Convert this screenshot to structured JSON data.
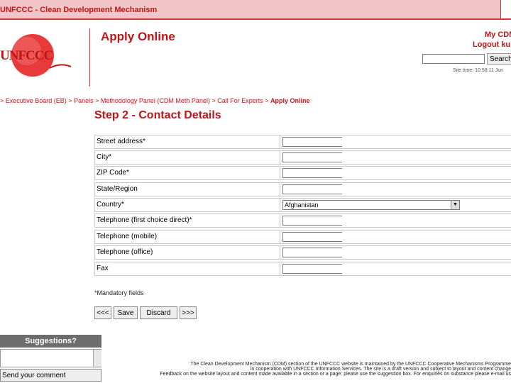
{
  "window": {
    "title": "UNFCCC - Clean Development Mechanism"
  },
  "header": {
    "logo_text": "UNFCCC",
    "page_title": "Apply Online",
    "my_cdm": "My CDM",
    "logout": "Logout ku",
    "search_button": "Search",
    "dateline": "Site time: 10:58:11 Jun"
  },
  "breadcrumb": {
    "items": [
      "> Executive Board (EB) >",
      "Panels >",
      "Methodology Panel (CDM Meth Panel) >",
      "Call For Experts >"
    ],
    "current": "Apply Online"
  },
  "form": {
    "step_title": "Step 2 - Contact Details",
    "rows": [
      {
        "label": "Street address*"
      },
      {
        "label": "City*"
      },
      {
        "label": "ZIP Code*"
      },
      {
        "label": "State/Region"
      },
      {
        "label": "Country*",
        "select_value": "Afghanistan"
      },
      {
        "label": "Telephone (first choice direct)*"
      },
      {
        "label": "Telephone (mobile)"
      },
      {
        "label": "Telephone (office)"
      },
      {
        "label": "Fax"
      }
    ],
    "mandatory_note": "*Mandatory fields",
    "buttons": {
      "prev": "<<<",
      "save": "Save",
      "discard": "Discard",
      "next": ">>>"
    }
  },
  "suggestions": {
    "heading": "Suggestions?",
    "send_button": "Send your comment"
  },
  "footer": {
    "lines": [
      "The Clean Development Mechanism (CDM) section of the UNFCCC website is maintained by the UNFCCC Cooperative Mechanisms Programme",
      "in cooperation with UNFCCC Information Services. The site is a draft version and subject to layout and content change",
      "Feedback on the website layout and content made available in a section or a page: please use the suggestion box. For enquiries on substance please e-mail us"
    ]
  },
  "colors": {
    "brand_red": "#c01616",
    "title_bar": "#f4c5c8",
    "grey_panel": "#6d6d6d"
  }
}
